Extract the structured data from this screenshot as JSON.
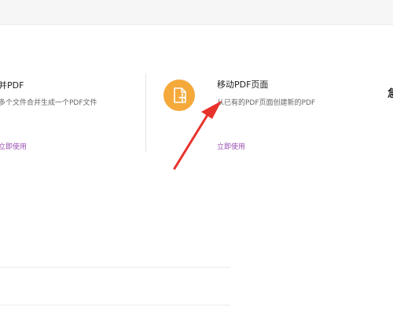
{
  "cards": [
    {
      "title": "并PDF",
      "description": "多个文件合并生成一个PDF文件",
      "link": "立即使用"
    },
    {
      "title": "移动PDF页面",
      "description": "从已有的PDF页面创建新的PDF",
      "link": "立即使用",
      "icon": "move-pages-icon",
      "icon_color": "#f4a93a"
    }
  ],
  "edge_text": "急",
  "colors": {
    "link": "#9b4fb4",
    "arrow": "#e8322c"
  }
}
